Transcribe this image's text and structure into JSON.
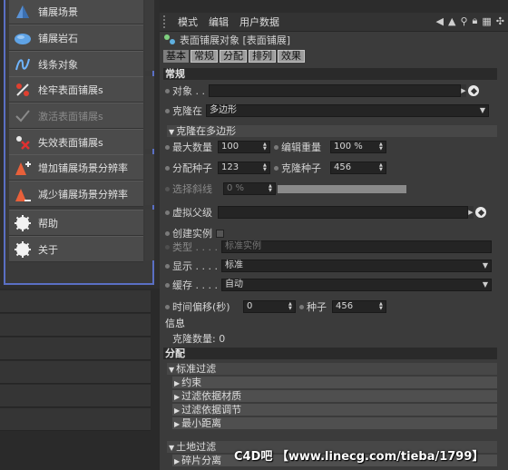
{
  "menu": {
    "items": [
      {
        "label": "铺展场景",
        "icon": "scatter-scene-icon",
        "disabled": false
      },
      {
        "label": "铺展岩石",
        "icon": "scatter-rock-icon",
        "disabled": false
      },
      {
        "label": "线条对象",
        "icon": "spline-object-icon",
        "disabled": false
      },
      {
        "label": "栓牢表面铺展s",
        "icon": "anchor-surface-scatter-icon",
        "disabled": false
      },
      {
        "label": "激活表面铺展s",
        "icon": "activate-surface-scatter-icon",
        "disabled": true
      },
      {
        "label": "失效表面铺展s",
        "icon": "deactivate-surface-scatter-icon",
        "disabled": false
      },
      {
        "label": "增加铺展场景分辨率",
        "icon": "increase-resolution-icon",
        "disabled": false
      },
      {
        "label": "减少铺展场景分辨率",
        "icon": "decrease-resolution-icon",
        "disabled": false
      },
      {
        "label": "帮助",
        "icon": "help-icon",
        "disabled": false
      },
      {
        "label": "关于",
        "icon": "about-icon",
        "disabled": false
      }
    ]
  },
  "panel": {
    "menubar": [
      "模式",
      "编辑",
      "用户数据"
    ],
    "object_title": "表面铺展对象 [表面铺展]",
    "tabs": [
      {
        "label": "基本",
        "active": false
      },
      {
        "label": "常规",
        "active": true
      },
      {
        "label": "分配",
        "active": true
      },
      {
        "label": "排列",
        "active": true
      },
      {
        "label": "效果",
        "active": true
      }
    ],
    "general": {
      "section": "常规",
      "object_label": "对象 . .",
      "clone_on_label": "克隆在",
      "clone_on_value": "多边形",
      "clone_on_poly_group": "克隆在多边形",
      "max_count_label": "最大数量",
      "max_count_value": "100",
      "edit_weight_label": "编辑重量",
      "edit_weight_value": "100 %",
      "dist_seed_label": "分配种子",
      "dist_seed_value": "123",
      "clone_seed_label": "克隆种子",
      "clone_seed_value": "456",
      "select_slope_label": "选择斜线",
      "select_slope_value": "0 %",
      "virtual_parent_label": "虚拟父级",
      "create_instance_label": "创建实例",
      "type_label": "类型 . . . .",
      "type_value": "标准实例",
      "display_label": "显示 . . . .",
      "display_value": "标准",
      "cache_label": "缓存 . . . .",
      "cache_value": "自动",
      "time_offset_label": "时间偏移(秒)",
      "time_offset_value": "0",
      "seed_label": "种子",
      "seed_value": "456"
    },
    "info": {
      "section": "信息",
      "clone_count": "克隆数量: 0"
    },
    "distribution": {
      "section": "分配",
      "standard_filter": "标准过滤",
      "items": [
        "约束",
        "过滤依据材质",
        "过滤依据调节",
        "最小距离"
      ],
      "ground_filter": "土地过滤",
      "ground_items": [
        "碎片分离"
      ]
    }
  },
  "watermark": "C4D吧 【www.linecg.com/tieba/1799】"
}
